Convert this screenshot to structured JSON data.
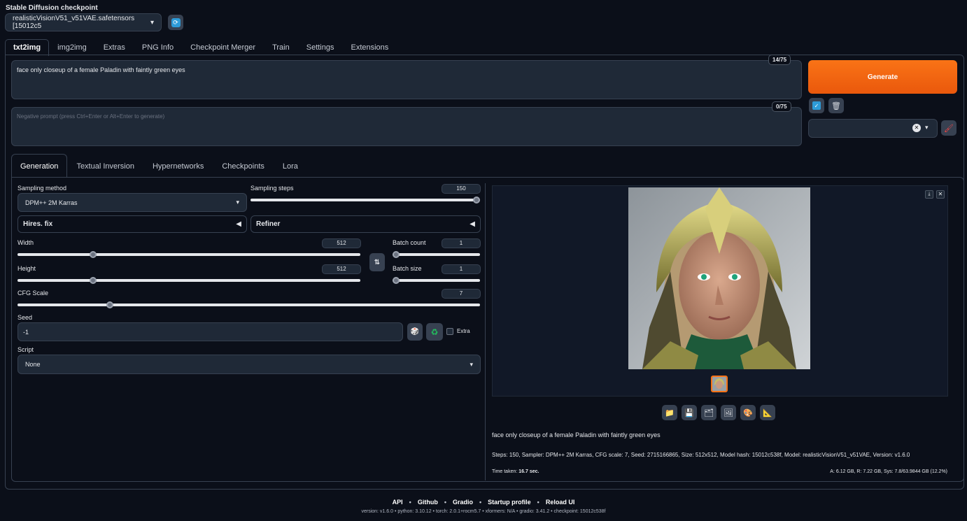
{
  "checkpoint": {
    "label": "Stable Diffusion checkpoint",
    "value": "realisticVisionV51_v51VAE.safetensors [15012c5"
  },
  "top_tabs": [
    {
      "label": "txt2img"
    },
    {
      "label": "img2img"
    },
    {
      "label": "Extras"
    },
    {
      "label": "PNG Info"
    },
    {
      "label": "Checkpoint Merger"
    },
    {
      "label": "Train"
    },
    {
      "label": "Settings"
    },
    {
      "label": "Extensions"
    }
  ],
  "prompt": {
    "value": "face only closeup of a female Paladin with faintly green eyes",
    "tokens": "14/75"
  },
  "negative_prompt": {
    "placeholder": "Negative prompt (press Ctrl+Enter or Alt+Enter to generate)",
    "tokens": "0/75"
  },
  "generate_label": "Generate",
  "sub_tabs": [
    {
      "label": "Generation"
    },
    {
      "label": "Textual Inversion"
    },
    {
      "label": "Hypernetworks"
    },
    {
      "label": "Checkpoints"
    },
    {
      "label": "Lora"
    }
  ],
  "params": {
    "sampling_method": {
      "label": "Sampling method",
      "value": "DPM++ 2M Karras"
    },
    "sampling_steps": {
      "label": "Sampling steps",
      "value": "150",
      "fraction": 1.0
    },
    "hires": {
      "label": "Hires. fix"
    },
    "refiner": {
      "label": "Refiner"
    },
    "width": {
      "label": "Width",
      "value": "512",
      "fraction": 0.22
    },
    "height": {
      "label": "Height",
      "value": "512",
      "fraction": 0.22
    },
    "batch_count": {
      "label": "Batch count",
      "value": "1",
      "fraction": 0.0
    },
    "batch_size": {
      "label": "Batch size",
      "value": "1",
      "fraction": 0.0
    },
    "cfg": {
      "label": "CFG Scale",
      "value": "7",
      "fraction": 0.2
    },
    "seed": {
      "label": "Seed",
      "value": "-1",
      "extra_label": "Extra"
    },
    "script": {
      "label": "Script",
      "value": "None"
    }
  },
  "output": {
    "prompt_text": "face only closeup of a female Paladin with faintly green eyes",
    "params_text": "Steps: 150, Sampler: DPM++ 2M Karras, CFG scale: 7, Seed: 2715166865, Size: 512x512, Model hash: 15012c538f, Model: realisticVisionV51_v51VAE, Version: v1.6.0",
    "time_label": "Time taken:",
    "time_value": "16.7 sec.",
    "vram": "A: 6.12 GB, R: 7.22 GB, Sys: 7.8/63.9844 GB (12.2%)"
  },
  "footer": {
    "links": [
      "API",
      "Github",
      "Gradio",
      "Startup profile",
      "Reload UI"
    ],
    "versions": "version: v1.6.0  •  python: 3.10.12  •  torch: 2.0.1+rocm5.7  •  xformers: N/A  •  gradio: 3.41.2  •  checkpoint: 15012c538f"
  },
  "colors": {
    "accent": "#f97316",
    "bg": "#0b0f19",
    "panel": "#1f2937",
    "border": "#374151"
  }
}
